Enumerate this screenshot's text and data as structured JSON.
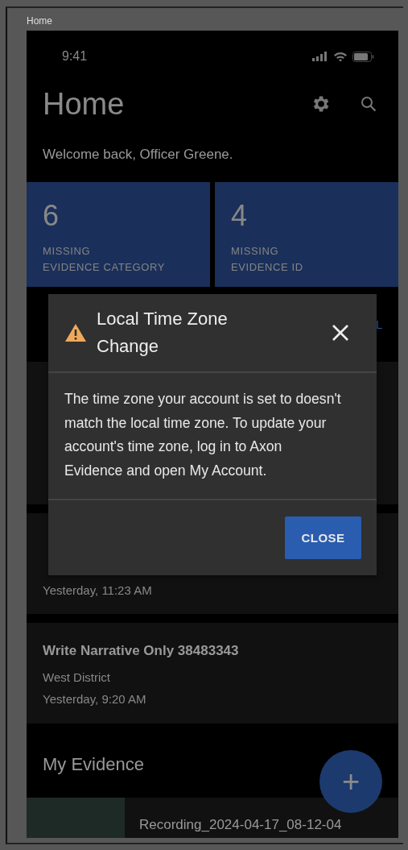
{
  "frame_label": "Home",
  "status_bar": {
    "time": "9:41"
  },
  "header": {
    "title": "Home",
    "welcome": "Welcome back, Officer Greene."
  },
  "tiles": [
    {
      "count": "6",
      "label_1": "MISSING",
      "label_2": "EVIDENCE CATEGORY"
    },
    {
      "count": "4",
      "label_1": "MISSING",
      "label_2": "EVIDENCE ID"
    }
  ],
  "section_1": {
    "link": "L"
  },
  "cards": [
    {
      "time": "Yesterday, 11:23 AM"
    },
    {
      "title": "Write Narrative Only 38483343",
      "district": "West District",
      "time": "Yesterday, 9:20 AM"
    }
  ],
  "evidence": {
    "heading": "My Evidence",
    "items": [
      {
        "title": "Recording_2024-04-17_08-12-04"
      }
    ]
  },
  "fab": {
    "label": "+"
  },
  "dialog": {
    "title": "Local Time Zone Change",
    "message": "The time zone your account is set to doesn't match the local time zone. To update your account's time zone, log in to Axon Evidence and open My Account.",
    "button": "CLOSE"
  }
}
